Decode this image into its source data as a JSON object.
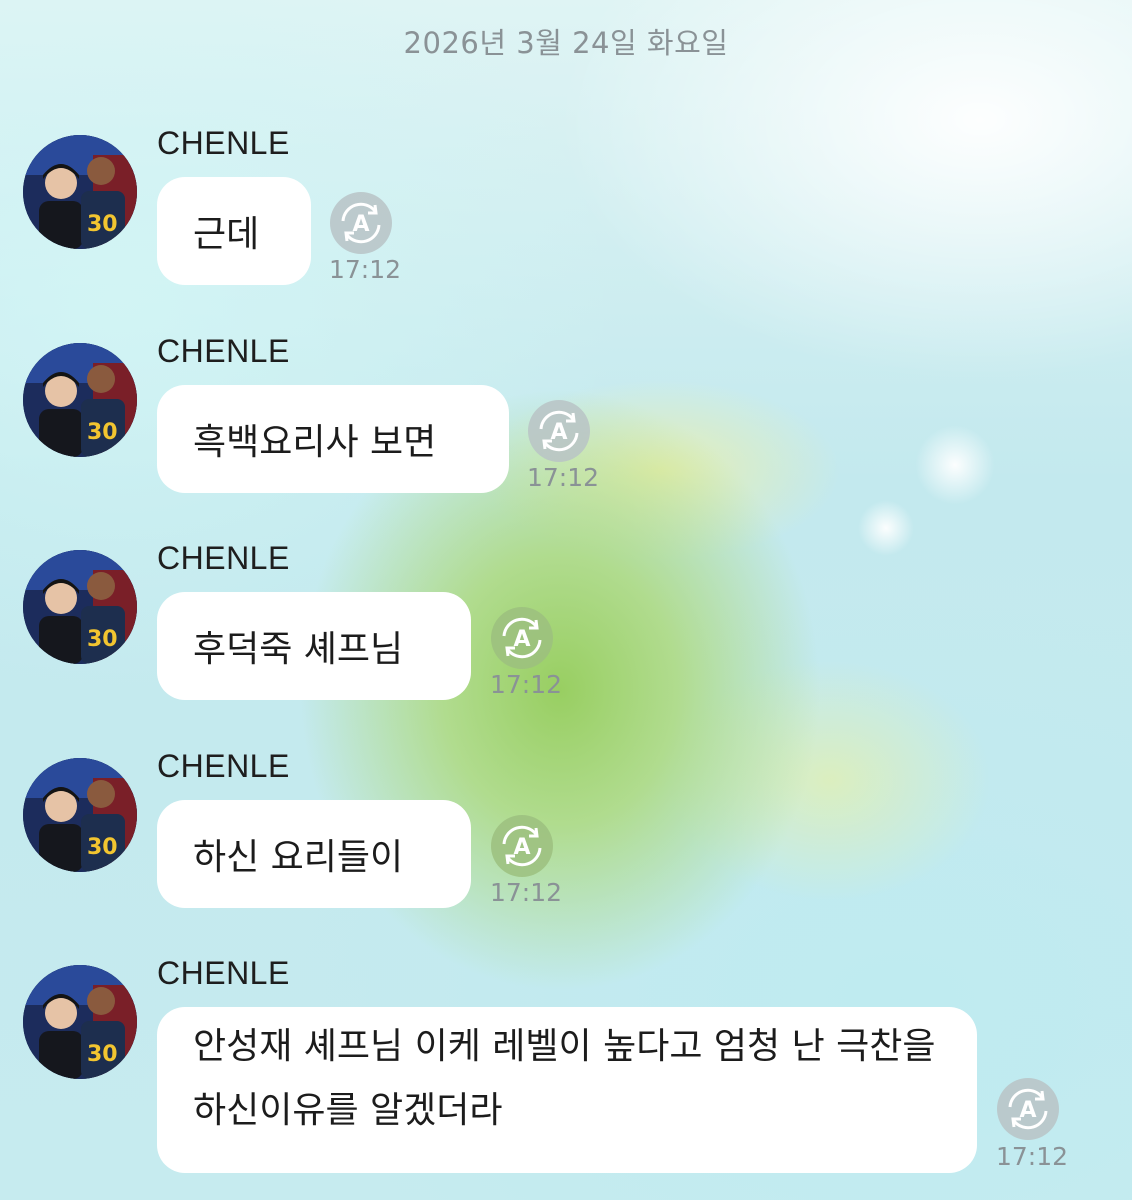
{
  "chat": {
    "date_header": "2026년 3월 24일 화요일",
    "messages": [
      {
        "sender": "CHENLE",
        "text": "근데",
        "time": "17:12"
      },
      {
        "sender": "CHENLE",
        "text": "흑백요리사 보면",
        "time": "17:12"
      },
      {
        "sender": "CHENLE",
        "text": "후덕죽 셰프님",
        "time": "17:12"
      },
      {
        "sender": "CHENLE",
        "text": "하신 요리들이",
        "time": "17:12"
      },
      {
        "sender": "CHENLE",
        "text": "안성재 셰프님 이케 레벨이 높다고 엄청 난 극찬을 하신이유를 알겠더라",
        "time": "17:12"
      }
    ]
  },
  "icons": {
    "avatar": "profile-photo",
    "translate": "auto-translate-icon"
  },
  "colors": {
    "bubble": "#ffffff",
    "meta_text": "#8a9296",
    "background": "#c9ecef",
    "island_green": "#9fd35f"
  }
}
